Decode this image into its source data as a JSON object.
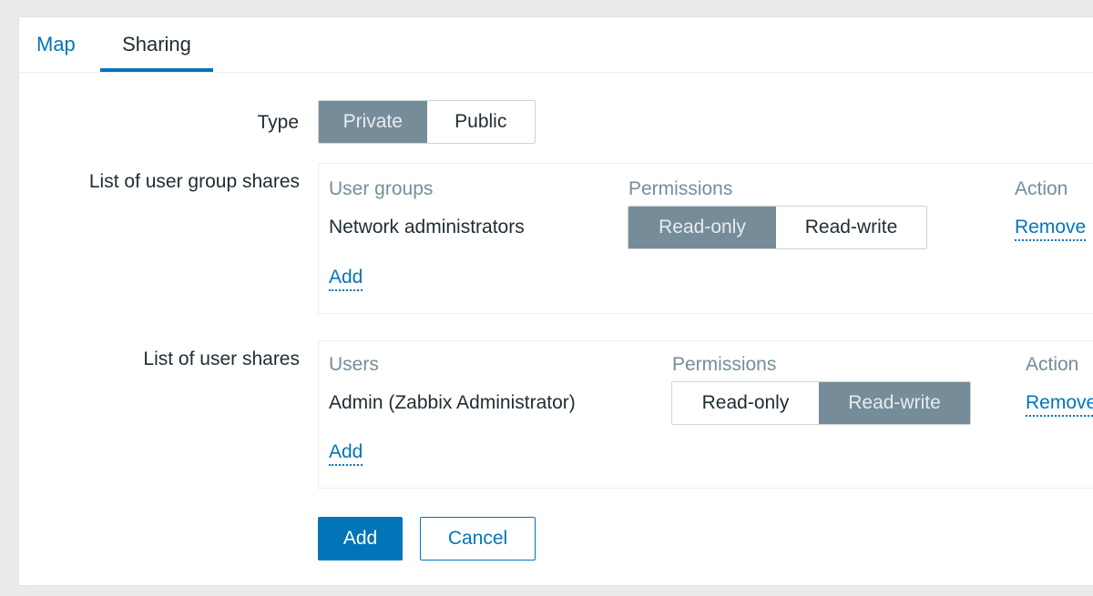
{
  "tabs": [
    {
      "label": "Map",
      "active": false
    },
    {
      "label": "Sharing",
      "active": true
    }
  ],
  "form": {
    "type_label": "Type",
    "type_options": [
      "Private",
      "Public"
    ],
    "type_selected": "Private",
    "group_shares_label": "List of user group shares",
    "user_shares_label": "List of user shares"
  },
  "group_shares": {
    "col_name": "User groups",
    "col_permissions": "Permissions",
    "col_action": "Action",
    "rows": [
      {
        "name": "Network administrators",
        "perm_options": [
          "Read-only",
          "Read-write"
        ],
        "selected": "Read-only",
        "action": "Remove"
      }
    ],
    "add_label": "Add"
  },
  "user_shares": {
    "col_name": "Users",
    "col_permissions": "Permissions",
    "col_action": "Action",
    "rows": [
      {
        "name": "Admin (Zabbix Administrator)",
        "perm_options": [
          "Read-only",
          "Read-write"
        ],
        "selected": "Read-write",
        "action": "Remove"
      }
    ],
    "add_label": "Add"
  },
  "buttons": {
    "add": "Add",
    "cancel": "Cancel"
  },
  "colors": {
    "accent": "#0275b8",
    "segment_active": "#768d99",
    "muted": "#768d99",
    "background": "#ebebeb"
  }
}
